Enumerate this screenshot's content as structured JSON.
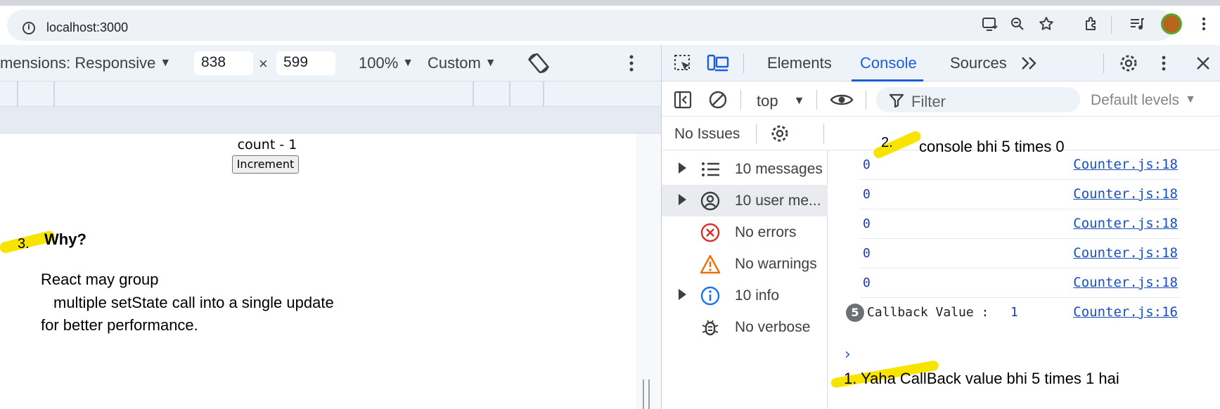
{
  "browser": {
    "url": "localhost:3000"
  },
  "device_toolbar": {
    "dimensions_label": "mensions: Responsive",
    "width": "838",
    "times": "×",
    "height": "599",
    "zoom": "100%",
    "throttle": "Custom"
  },
  "page": {
    "count_text": "count - 1",
    "increment_label": "Increment"
  },
  "annotations": {
    "why_number": "3.",
    "why_title": "Why?",
    "why_line1": "React may group",
    "why_line2": "multiple setState call into a single update",
    "why_line3": "for better performance.",
    "note2_number": "2.",
    "note2_text": "console bhi 5 times 0",
    "note1_text": "1. Yaha CallBack value bhi 5 times 1 hai",
    "highlight_color": "#f7e400"
  },
  "devtools": {
    "tabs": [
      {
        "label": "Elements"
      },
      {
        "label": "Console"
      },
      {
        "label": "Sources"
      }
    ],
    "active_tab": "Console",
    "accent_color": "#1a5fd6",
    "context": "top",
    "filter_placeholder": "Filter",
    "levels": "Default levels",
    "issues": "No Issues",
    "sidebar": [
      {
        "label": "10 messages",
        "icon": "list-icon"
      },
      {
        "label": "10 user me...",
        "icon": "user-icon"
      },
      {
        "label": "No errors",
        "icon": "error-icon"
      },
      {
        "label": "No warnings",
        "icon": "warning-icon"
      },
      {
        "label": "10 info",
        "icon": "info-icon"
      },
      {
        "label": "No verbose",
        "icon": "bug-icon"
      }
    ],
    "logs": [
      {
        "value": "0",
        "source": "Counter.js:18"
      },
      {
        "value": "0",
        "source": "Counter.js:18"
      },
      {
        "value": "0",
        "source": "Counter.js:18"
      },
      {
        "value": "0",
        "source": "Counter.js:18"
      },
      {
        "value": "0",
        "source": "Counter.js:18"
      }
    ],
    "grouped_log": {
      "count": "5",
      "text": "Callback Value :",
      "value": "1",
      "source": "Counter.js:16"
    },
    "prompt": "›"
  }
}
